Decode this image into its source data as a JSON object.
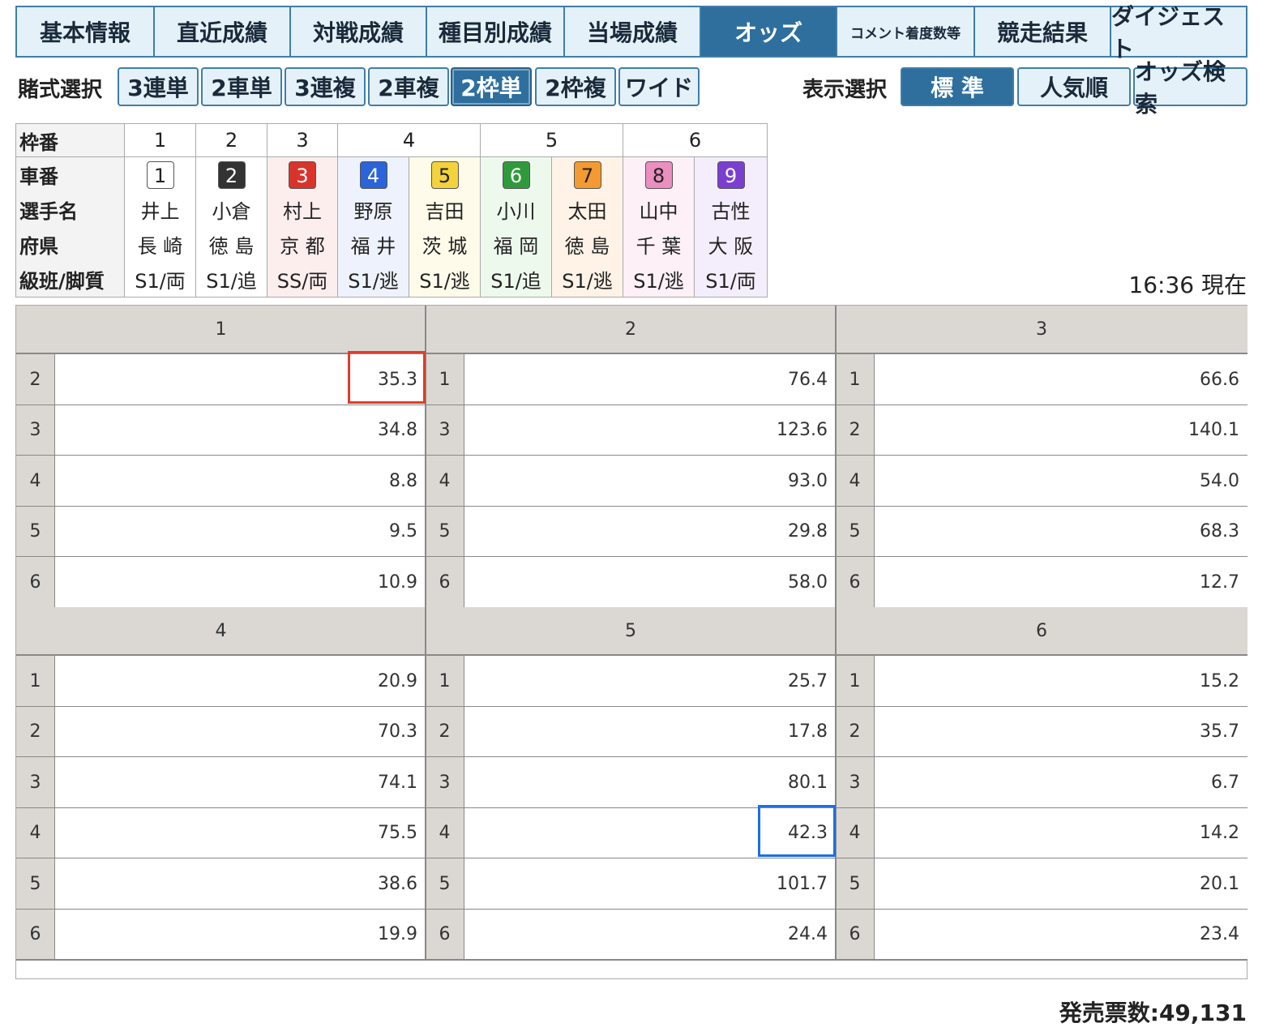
{
  "nav": {
    "tabs": [
      "基本情報",
      "直近成績",
      "対戦成績",
      "種目別成績",
      "当場成績",
      "オッズ",
      "コメント着度数等",
      "競走結果",
      "ダイジェスト"
    ],
    "active": "オッズ"
  },
  "bet_select": {
    "label": "賭式選択",
    "options": [
      "3連単",
      "2車単",
      "3連複",
      "2車複",
      "2枠単",
      "2枠複",
      "ワイド"
    ],
    "active": "2枠単"
  },
  "display_select": {
    "label": "表示選択",
    "options": [
      "標 準",
      "人気順",
      "オッズ検索"
    ],
    "active": "標 準"
  },
  "riders": {
    "labels": {
      "frame": "枠番",
      "car": "車番",
      "name": "選手名",
      "pref": "府県",
      "class": "級班/脚質"
    },
    "frames": [
      "1",
      "2",
      "3",
      "4",
      "5",
      "6"
    ],
    "list": [
      {
        "frame": "1",
        "car": "1",
        "name": "井上",
        "pref": "長 崎",
        "class": "S1/両",
        "color": "#ffffff",
        "text": "#222222",
        "bg": "#ffffff"
      },
      {
        "frame": "2",
        "car": "2",
        "name": "小倉",
        "pref": "徳 島",
        "class": "S1/追",
        "color": "#333333",
        "text": "#ffffff",
        "bg": "#ffffff"
      },
      {
        "frame": "3",
        "car": "3",
        "name": "村上",
        "pref": "京 都",
        "class": "SS/両",
        "color": "#d9342b",
        "text": "#ffffff",
        "bg": "#fdeeee"
      },
      {
        "frame": "4",
        "car": "4",
        "name": "野原",
        "pref": "福 井",
        "class": "S1/逃",
        "color": "#2b63d9",
        "text": "#ffffff",
        "bg": "#eef2fd"
      },
      {
        "frame": "4",
        "car": "5",
        "name": "吉田",
        "pref": "茨 城",
        "class": "S1/逃",
        "color": "#f3d23c",
        "text": "#222222",
        "bg": "#fefbea"
      },
      {
        "frame": "5",
        "car": "6",
        "name": "小川",
        "pref": "福 岡",
        "class": "S1/追",
        "color": "#2f9a3c",
        "text": "#ffffff",
        "bg": "#eef9ee"
      },
      {
        "frame": "5",
        "car": "7",
        "name": "太田",
        "pref": "徳 島",
        "class": "S1/逃",
        "color": "#f39a32",
        "text": "#222222",
        "bg": "#fef3e6"
      },
      {
        "frame": "6",
        "car": "8",
        "name": "山中",
        "pref": "千 葉",
        "class": "S1/逃",
        "color": "#ea8fbf",
        "text": "#222222",
        "bg": "#fdf0f6"
      },
      {
        "frame": "6",
        "car": "9",
        "name": "古性",
        "pref": "大 阪",
        "class": "S1/両",
        "color": "#7a3fd0",
        "text": "#ffffff",
        "bg": "#f4eefc"
      }
    ]
  },
  "timestamp": "16:36 現在",
  "odds": {
    "groups": [
      {
        "first": "1",
        "rows": [
          [
            "2",
            "35.3"
          ],
          [
            "3",
            "34.8"
          ],
          [
            "4",
            "8.8"
          ],
          [
            "5",
            "9.5"
          ],
          [
            "6",
            "10.9"
          ]
        ]
      },
      {
        "first": "2",
        "rows": [
          [
            "1",
            "76.4"
          ],
          [
            "3",
            "123.6"
          ],
          [
            "4",
            "93.0"
          ],
          [
            "5",
            "29.8"
          ],
          [
            "6",
            "58.0"
          ]
        ]
      },
      {
        "first": "3",
        "rows": [
          [
            "1",
            "66.6"
          ],
          [
            "2",
            "140.1"
          ],
          [
            "4",
            "54.0"
          ],
          [
            "5",
            "68.3"
          ],
          [
            "6",
            "12.7"
          ]
        ]
      },
      {
        "first": "4",
        "rows": [
          [
            "1",
            "20.9"
          ],
          [
            "2",
            "70.3"
          ],
          [
            "3",
            "74.1"
          ],
          [
            "4",
            "75.5"
          ],
          [
            "5",
            "38.6"
          ],
          [
            "6",
            "19.9"
          ]
        ]
      },
      {
        "first": "5",
        "rows": [
          [
            "1",
            "25.7"
          ],
          [
            "2",
            "17.8"
          ],
          [
            "3",
            "80.1"
          ],
          [
            "4",
            "42.3"
          ],
          [
            "5",
            "101.7"
          ],
          [
            "6",
            "24.4"
          ]
        ]
      },
      {
        "first": "6",
        "rows": [
          [
            "1",
            "15.2"
          ],
          [
            "2",
            "35.7"
          ],
          [
            "3",
            "6.7"
          ],
          [
            "4",
            "14.2"
          ],
          [
            "5",
            "20.1"
          ],
          [
            "6",
            "23.4"
          ]
        ]
      }
    ],
    "highlight_red": {
      "group": 0,
      "row": 0
    },
    "highlight_blue": {
      "group": 4,
      "row": 3
    }
  },
  "sales": "発売票数:49,131"
}
